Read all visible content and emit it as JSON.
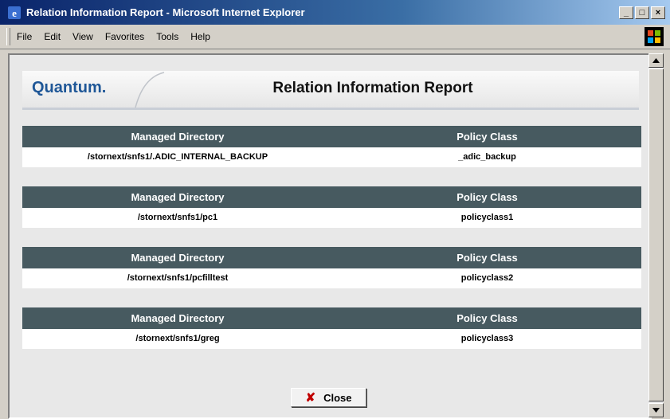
{
  "window": {
    "title": "Relation Information Report - Microsoft Internet Explorer",
    "controls": {
      "minimize": "_",
      "maximize": "□",
      "close": "×"
    }
  },
  "menu": {
    "items": [
      "File",
      "Edit",
      "View",
      "Favorites",
      "Tools",
      "Help"
    ]
  },
  "banner": {
    "logo": "Quantum.",
    "title": "Relation Information Report"
  },
  "tables": [
    {
      "headers": [
        "Managed Directory",
        "Policy Class"
      ],
      "directory": "/stornext/snfs1/.ADIC_INTERNAL_BACKUP",
      "policy_class": "_adic_backup"
    },
    {
      "headers": [
        "Managed Directory",
        "Policy Class"
      ],
      "directory": "/stornext/snfs1/pc1",
      "policy_class": "policyclass1"
    },
    {
      "headers": [
        "Managed Directory",
        "Policy Class"
      ],
      "directory": "/stornext/snfs1/pcfilltest",
      "policy_class": "policyclass2"
    },
    {
      "headers": [
        "Managed Directory",
        "Policy Class"
      ],
      "directory": "/stornext/snfs1/greg",
      "policy_class": "policyclass3"
    }
  ],
  "close_button": {
    "label": "Close",
    "icon": "red-x-icon"
  },
  "colors": {
    "header_bg": "#475a60",
    "logo": "#1f5797",
    "close_icon": "#c00000"
  }
}
